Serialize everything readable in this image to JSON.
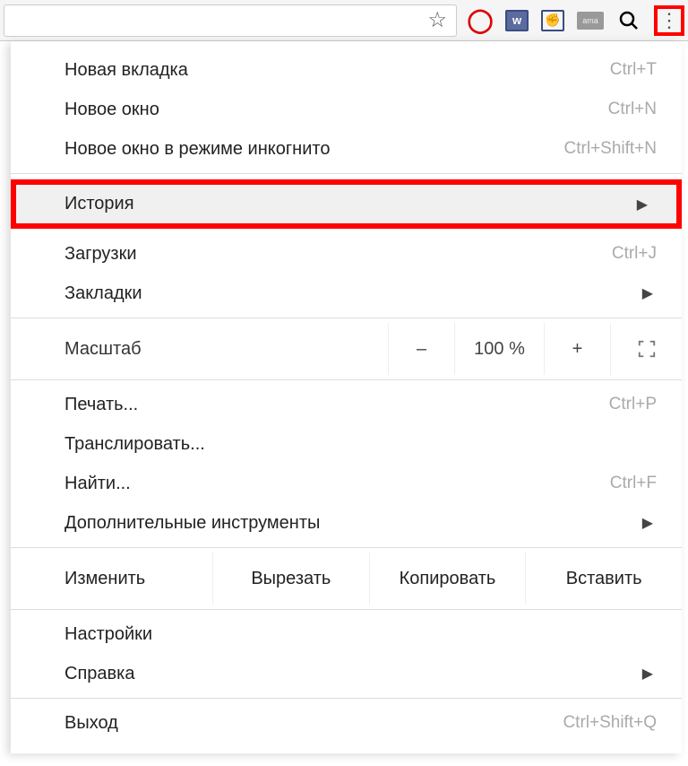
{
  "toolbar": {
    "ext_icons": {
      "adblock": "adblock-icon",
      "vk": "w",
      "fist": "✊",
      "ama": "ama",
      "search": "search-icon",
      "menu": "menu-icon"
    }
  },
  "menu": {
    "new_tab": {
      "label": "Новая вкладка",
      "shortcut": "Ctrl+T"
    },
    "new_window": {
      "label": "Новое окно",
      "shortcut": "Ctrl+N"
    },
    "incognito": {
      "label": "Новое окно в режиме инкогнито",
      "shortcut": "Ctrl+Shift+N"
    },
    "history": {
      "label": "История"
    },
    "downloads": {
      "label": "Загрузки",
      "shortcut": "Ctrl+J"
    },
    "bookmarks": {
      "label": "Закладки"
    },
    "zoom": {
      "label": "Масштаб",
      "minus": "–",
      "value": "100 %",
      "plus": "+"
    },
    "print": {
      "label": "Печать...",
      "shortcut": "Ctrl+P"
    },
    "cast": {
      "label": "Транслировать..."
    },
    "find": {
      "label": "Найти...",
      "shortcut": "Ctrl+F"
    },
    "more_tools": {
      "label": "Дополнительные инструменты"
    },
    "edit": {
      "label": "Изменить",
      "cut": "Вырезать",
      "copy": "Копировать",
      "paste": "Вставить"
    },
    "settings": {
      "label": "Настройки"
    },
    "help": {
      "label": "Справка"
    },
    "exit": {
      "label": "Выход",
      "shortcut": "Ctrl+Shift+Q"
    }
  }
}
